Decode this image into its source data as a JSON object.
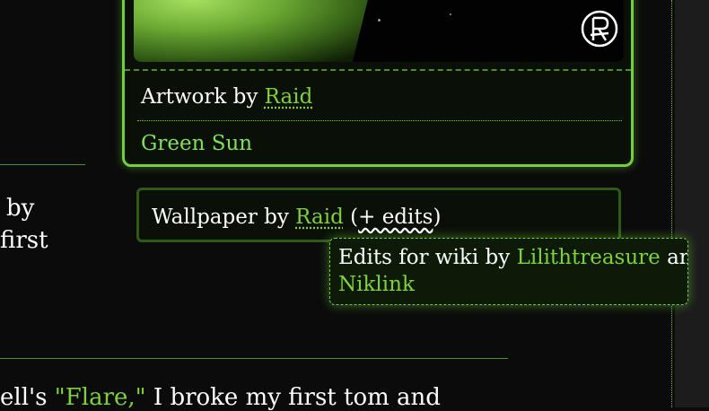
{
  "infobox": {
    "credit_prefix": "Artwork by",
    "credit_link": "Raid",
    "title": "Green Sun"
  },
  "left_text": {
    "line1": "by",
    "line2": "first",
    "bottom_prefix": "ell's",
    "bottom_link": "\"Flare,\"",
    "bottom_suffix": "I broke my first tom and"
  },
  "wallpaper": {
    "prefix": "Wallpaper by",
    "link": "Raid",
    "paren_open": "(",
    "edits_label": "+ edits",
    "paren_close": ")"
  },
  "tooltip": {
    "prefix": "Edits for wiki by",
    "user1": "Lilithtreasure",
    "joiner": "and",
    "user2": "Niklink"
  },
  "colors": {
    "background": "#0b0b0b",
    "accent": "#7fd13b",
    "border": "#6fd13b"
  }
}
